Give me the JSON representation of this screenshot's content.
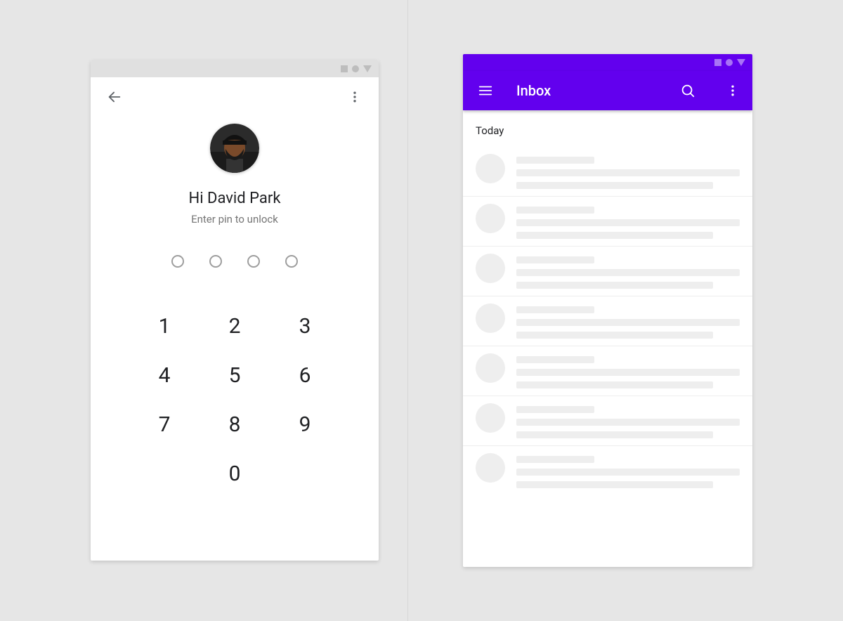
{
  "pin_screen": {
    "greeting": "Hi David Park",
    "subtitle": "Enter pin to unlock",
    "pin_length": 4,
    "keypad": [
      "1",
      "2",
      "3",
      "4",
      "5",
      "6",
      "7",
      "8",
      "9",
      "",
      "0",
      ""
    ]
  },
  "inbox_screen": {
    "title": "Inbox",
    "section_header": "Today"
  },
  "colors": {
    "primary": "#6200ee",
    "grey_bg": "#e0e0e0"
  }
}
